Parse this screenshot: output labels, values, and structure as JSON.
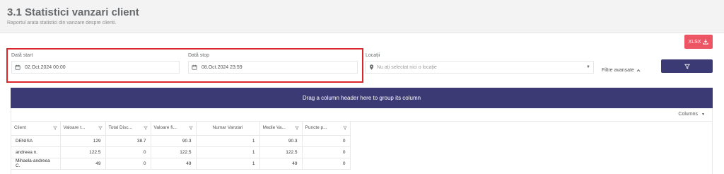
{
  "header": {
    "title": "3.1 Statistici vanzari client",
    "subtitle": "Raportul arata statistici din vanzare despre clienti."
  },
  "toolbar": {
    "xlsx_label": "XLSX",
    "filter_icon": "funnel-icon"
  },
  "filters": {
    "start_label": "Dată start",
    "start_value": "02.Oct.2024 00:00",
    "stop_label": "Dată stop",
    "stop_value": "08.Oct.2024 23:59",
    "location_label": "Locații",
    "location_placeholder": "Nu ați selectat nici o locație",
    "advanced_label": "Filtre avansate"
  },
  "grid": {
    "group_hint": "Drag a column header here to group its column",
    "columns_label": "Columns",
    "headers": [
      "Client",
      "Valoare t...",
      "Total Disc...",
      "Valoare fi...",
      "Numar Vanzari",
      "Medie Va...",
      "Puncte p..."
    ],
    "rows": [
      [
        "DENISA",
        "129",
        "38.7",
        "90.3",
        "1",
        "90.3",
        "0"
      ],
      [
        "andreea n.",
        "122.5",
        "0",
        "122.5",
        "1",
        "122.5",
        "0"
      ],
      [
        "Mihaela-andreea C.",
        "49",
        "0",
        "49",
        "1",
        "49",
        "0"
      ]
    ]
  },
  "colors": {
    "accent": "#3c3a75",
    "export": "#ed5565",
    "highlight": "#d9262a"
  }
}
